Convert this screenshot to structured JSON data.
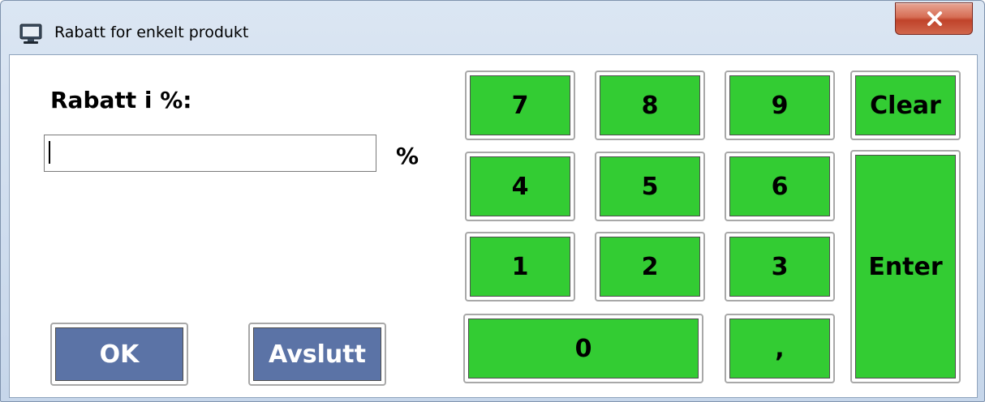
{
  "window": {
    "title": "Rabatt for enkelt produkt",
    "icon": "monitor-icon",
    "close_icon": "close-icon"
  },
  "form": {
    "label": "Rabatt i %:",
    "input_value": "",
    "unit": "%"
  },
  "buttons": {
    "ok": "OK",
    "exit": "Avslutt"
  },
  "keypad": {
    "k7": "7",
    "k8": "8",
    "k9": "9",
    "k4": "4",
    "k5": "5",
    "k6": "6",
    "k1": "1",
    "k2": "2",
    "k3": "3",
    "k0": "0",
    "comma": ",",
    "clear": "Clear",
    "enter": "Enter"
  },
  "colors": {
    "keypad_green": "#33cc33",
    "action_blue": "#5b73a6",
    "close_red": "#c0432a"
  }
}
